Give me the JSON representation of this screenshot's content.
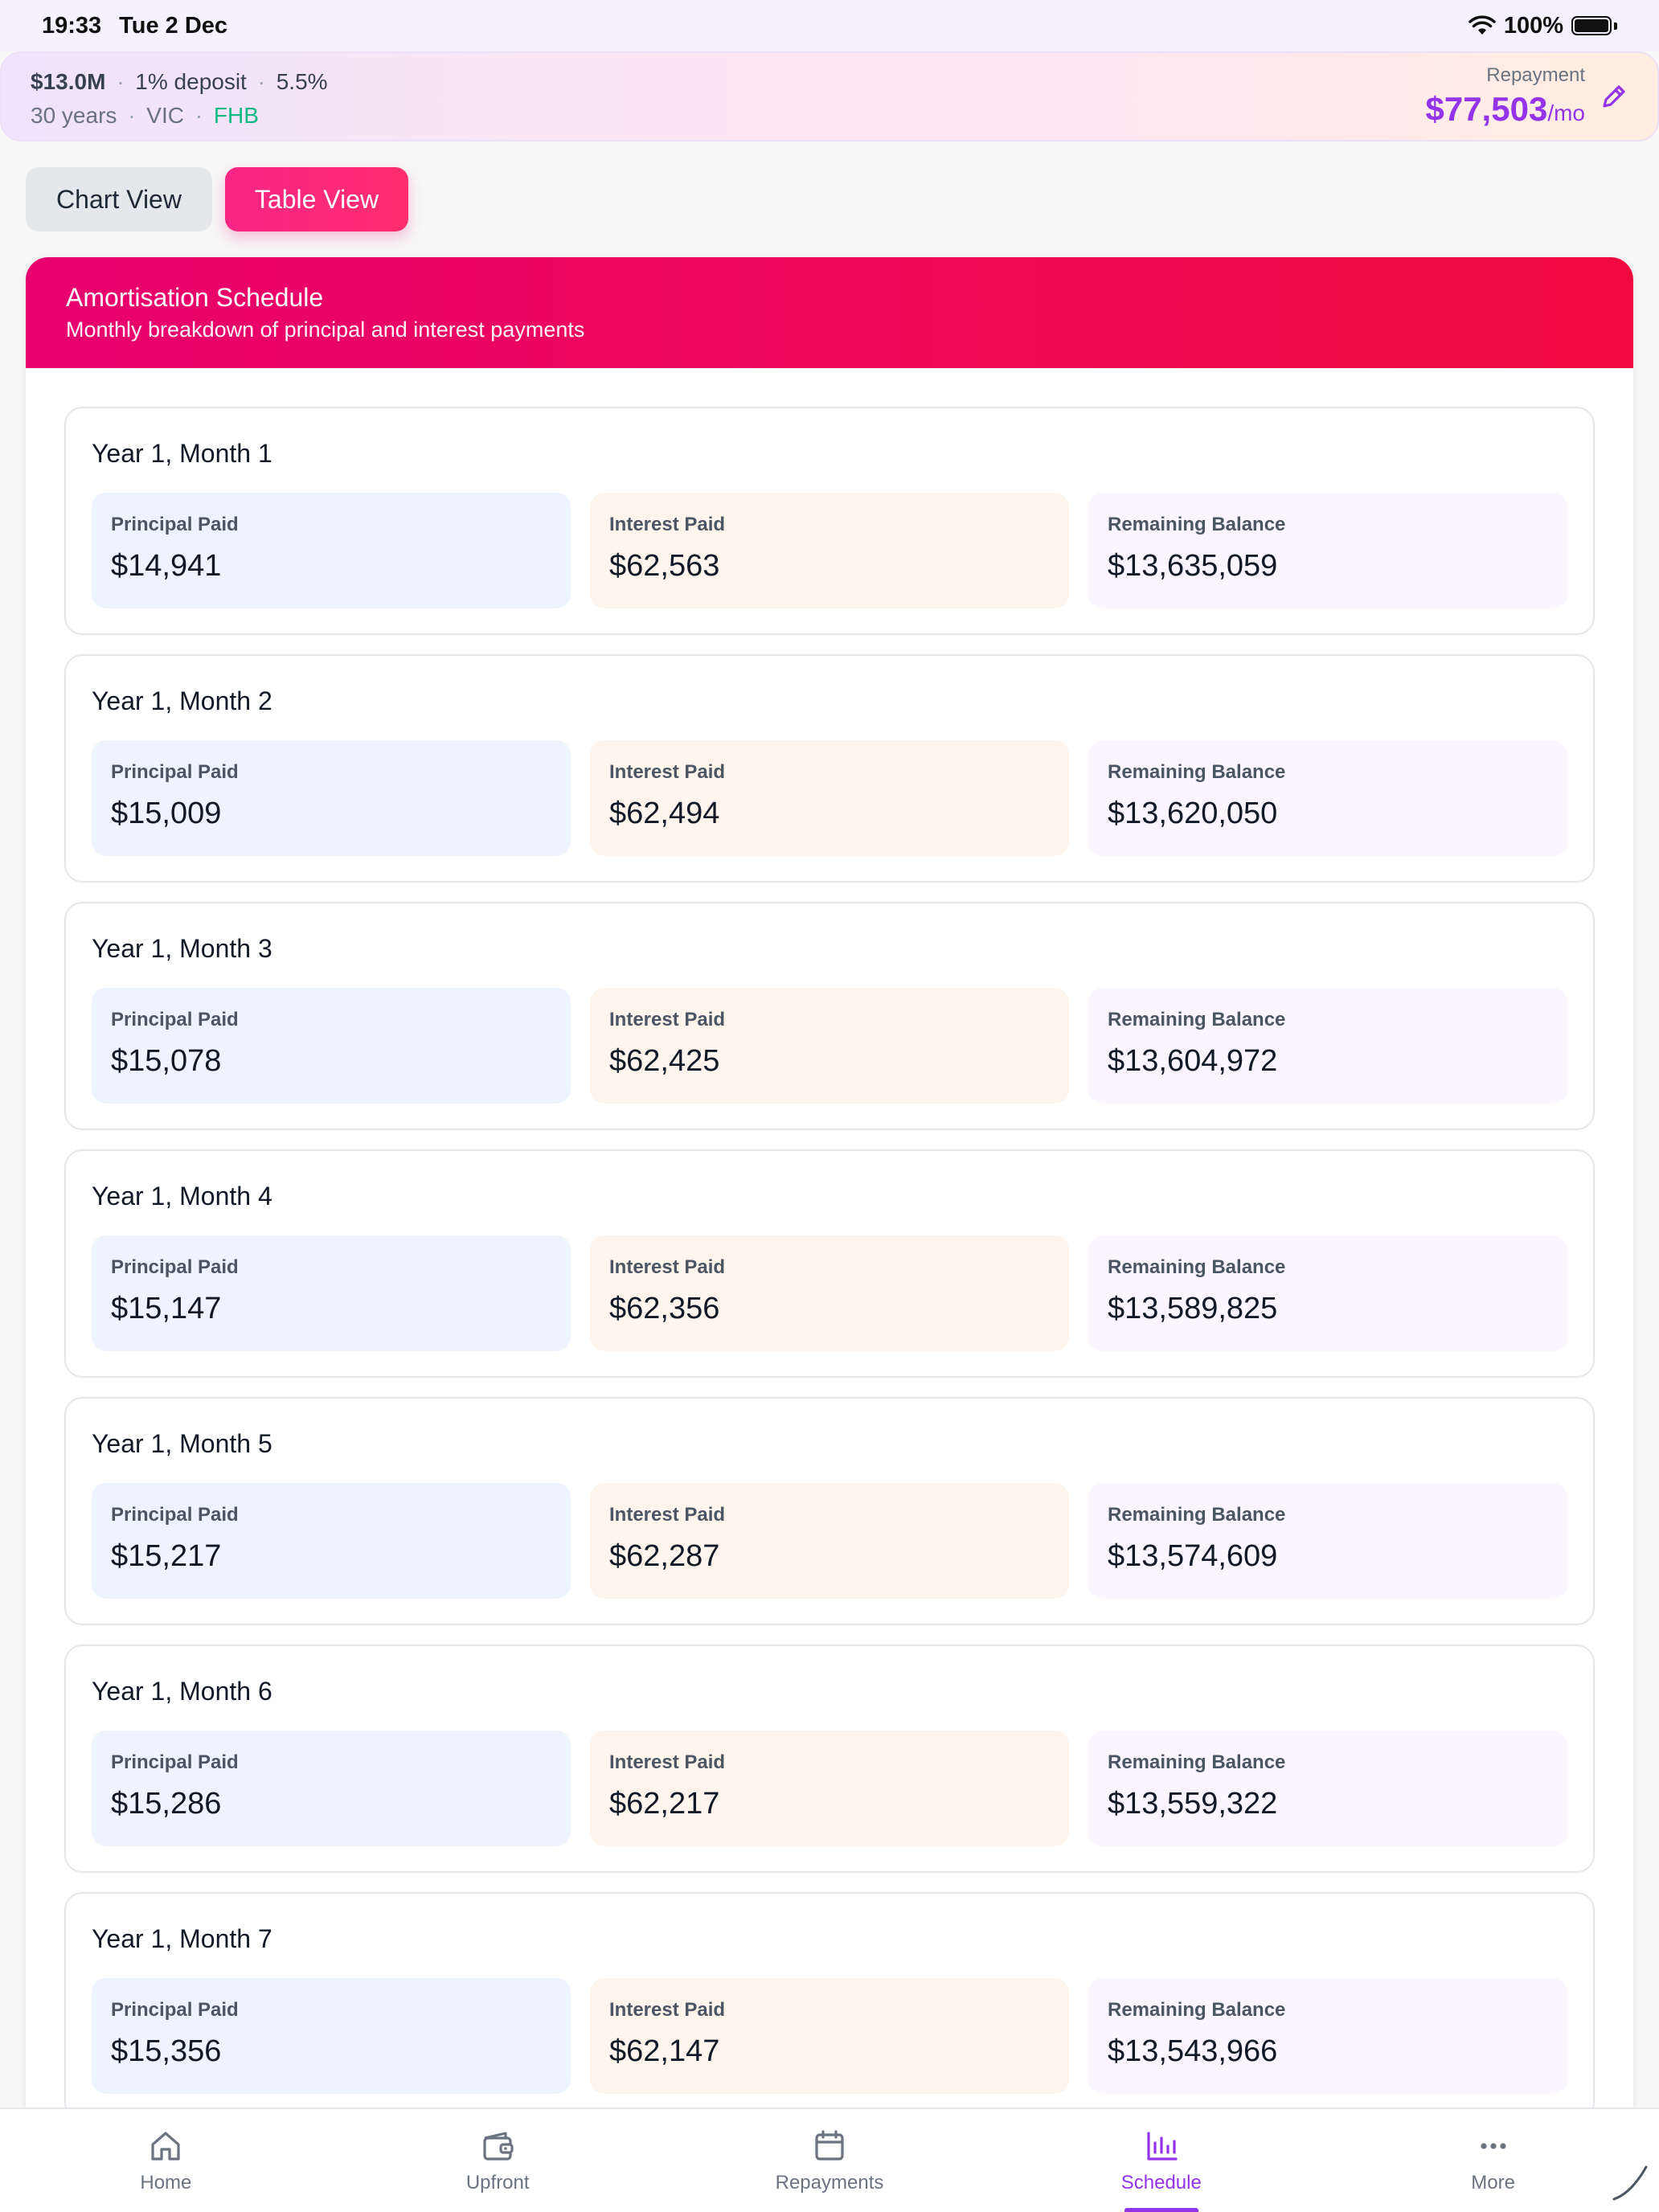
{
  "status_bar": {
    "time": "19:33",
    "date": "Tue 2 Dec",
    "battery": "100%"
  },
  "summary": {
    "loan_amount": "$13.0M",
    "deposit": "1% deposit",
    "rate": "5.5%",
    "term": "30 years",
    "state": "VIC",
    "buyer_type": "FHB",
    "repayment_label": "Repayment",
    "repayment_amount": "$77,503",
    "repayment_unit": "/mo",
    "separator": "·"
  },
  "view_toggle": {
    "chart_label": "Chart View",
    "table_label": "Table View",
    "active": "table"
  },
  "schedule": {
    "title": "Amortisation Schedule",
    "subtitle": "Monthly breakdown of principal and interest payments",
    "labels": {
      "principal": "Principal Paid",
      "interest": "Interest Paid",
      "balance": "Remaining Balance"
    },
    "months": [
      {
        "title": "Year 1, Month 1",
        "principal": "$14,941",
        "interest": "$62,563",
        "balance": "$13,635,059"
      },
      {
        "title": "Year 1, Month 2",
        "principal": "$15,009",
        "interest": "$62,494",
        "balance": "$13,620,050"
      },
      {
        "title": "Year 1, Month 3",
        "principal": "$15,078",
        "interest": "$62,425",
        "balance": "$13,604,972"
      },
      {
        "title": "Year 1, Month 4",
        "principal": "$15,147",
        "interest": "$62,356",
        "balance": "$13,589,825"
      },
      {
        "title": "Year 1, Month 5",
        "principal": "$15,217",
        "interest": "$62,287",
        "balance": "$13,574,609"
      },
      {
        "title": "Year 1, Month 6",
        "principal": "$15,286",
        "interest": "$62,217",
        "balance": "$13,559,322"
      },
      {
        "title": "Year 1, Month 7",
        "principal": "$15,356",
        "interest": "$62,147",
        "balance": "$13,543,966"
      }
    ]
  },
  "tab_bar": {
    "items": [
      {
        "label": "Home",
        "icon": "home-icon"
      },
      {
        "label": "Upfront",
        "icon": "wallet-icon"
      },
      {
        "label": "Repayments",
        "icon": "calendar-icon"
      },
      {
        "label": "Schedule",
        "icon": "bar-chart-icon"
      },
      {
        "label": "More",
        "icon": "more-icon"
      }
    ],
    "active": "Schedule"
  },
  "colors": {
    "accent": "#9333ea",
    "header_gradient_start": "#e8006f",
    "header_gradient_end": "#f00a3e",
    "fhb": "#10b981",
    "principal_bg": "#eef4ff",
    "interest_bg": "#fff5ec",
    "balance_bg": "#faf5ff"
  }
}
